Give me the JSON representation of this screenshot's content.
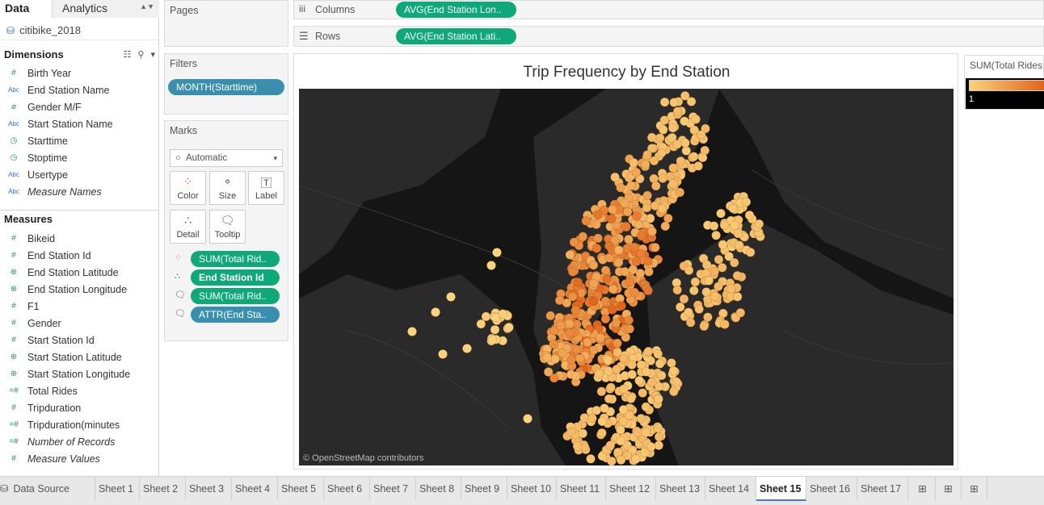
{
  "left_pane": {
    "tab_data": "Data",
    "tab_analytics": "Analytics",
    "datasource": "citibike_2018",
    "dimensions_title": "Dimensions",
    "dimensions": [
      {
        "icon": "#",
        "label": "Birth Year",
        "italic": false
      },
      {
        "icon": "Abc",
        "label": "End Station Name",
        "italic": false
      },
      {
        "icon": "⌀",
        "label": "Gender M/F",
        "italic": false
      },
      {
        "icon": "Abc",
        "label": "Start Station Name",
        "italic": false
      },
      {
        "icon": "◷",
        "label": "Starttime",
        "italic": false
      },
      {
        "icon": "◷",
        "label": "Stoptime",
        "italic": false
      },
      {
        "icon": "Abc",
        "label": "Usertype",
        "italic": false
      },
      {
        "icon": "Abc",
        "label": "Measure Names",
        "italic": true
      }
    ],
    "measures_title": "Measures",
    "measures": [
      {
        "icon": "#",
        "label": "Bikeid",
        "italic": false
      },
      {
        "icon": "#",
        "label": "End Station Id",
        "italic": false
      },
      {
        "icon": "⊕",
        "label": "End Station Latitude",
        "italic": false
      },
      {
        "icon": "⊕",
        "label": "End Station Longitude",
        "italic": false
      },
      {
        "icon": "#",
        "label": "F1",
        "italic": false
      },
      {
        "icon": "#",
        "label": "Gender",
        "italic": false
      },
      {
        "icon": "#",
        "label": "Start Station Id",
        "italic": false
      },
      {
        "icon": "⊕",
        "label": "Start Station Latitude",
        "italic": false
      },
      {
        "icon": "⊕",
        "label": "Start Station Longitude",
        "italic": false
      },
      {
        "icon": "=#",
        "label": "Total Rides",
        "italic": false
      },
      {
        "icon": "#",
        "label": "Tripduration",
        "italic": false
      },
      {
        "icon": "=#",
        "label": "Tripduration(minutes",
        "italic": false
      },
      {
        "icon": "=#",
        "label": "Number of Records",
        "italic": true
      },
      {
        "icon": "#",
        "label": "Measure Values",
        "italic": true
      }
    ]
  },
  "shelves": {
    "pages": "Pages",
    "filters": "Filters",
    "filter_pill": "MONTH(Starttime)",
    "marks": "Marks",
    "mark_type": "Automatic",
    "mark_buttons": [
      "Color",
      "Size",
      "Label",
      "Detail",
      "Tooltip"
    ],
    "mark_pills": [
      "SUM(Total Rid..",
      "End Station Id",
      "SUM(Total Rid..",
      "ATTR(End Sta.."
    ],
    "columns_label": "Columns",
    "columns_pill": "AVG(End Station Lon..",
    "rows_label": "Rows",
    "rows_pill": "AVG(End Station Lati.."
  },
  "viz": {
    "title": "Trip Frequency by End Station",
    "attribution": "© OpenStreetMap contributors"
  },
  "legend": {
    "title": "SUM(Total Rides",
    "min_label": "1"
  },
  "sheet_tabs": {
    "datasource_tab": "Data Source",
    "sheets": [
      "Sheet 1",
      "Sheet 2",
      "Sheet 3",
      "Sheet 4",
      "Sheet 5",
      "Sheet 6",
      "Sheet 7",
      "Sheet 8",
      "Sheet 9",
      "Sheet 10",
      "Sheet 11",
      "Sheet 12",
      "Sheet 13",
      "Sheet 14",
      "Sheet 15",
      "Sheet 16",
      "Sheet 17"
    ],
    "active": "Sheet 15"
  },
  "colors": {
    "green_pill": "#0fa879",
    "blue_pill": "#3a8fae",
    "dot_light": "#fcd27a",
    "dot_dark": "#e2641b"
  }
}
